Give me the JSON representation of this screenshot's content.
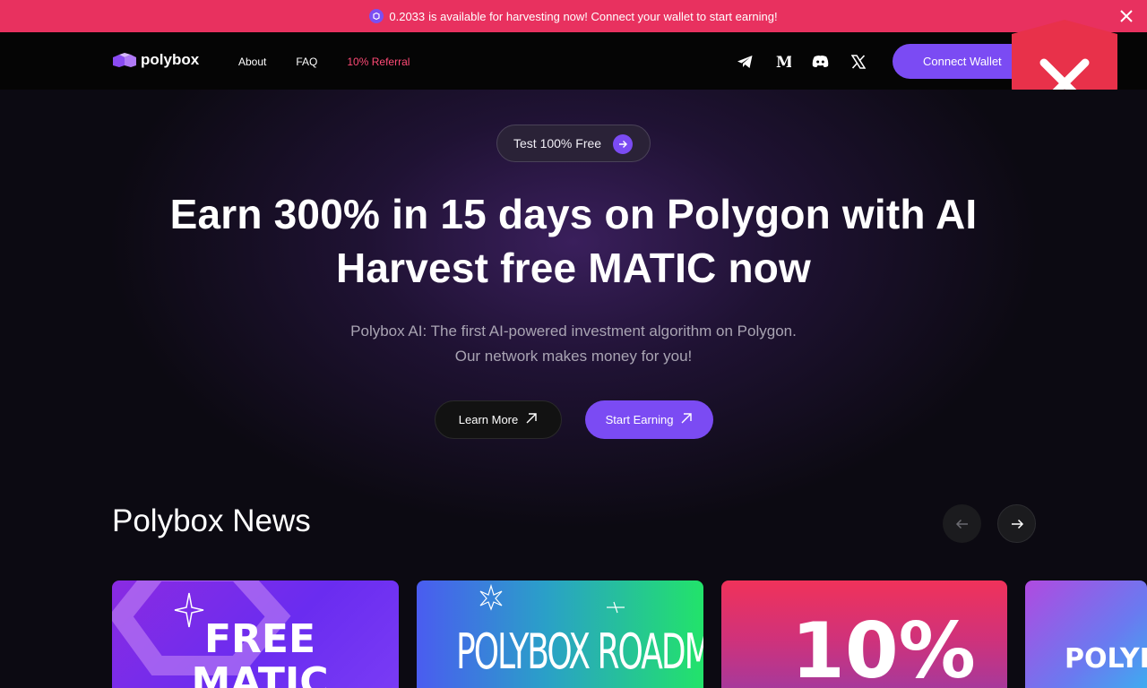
{
  "announcement": {
    "amount": "0.2033",
    "message": "is available for harvesting now! Connect your wallet to start earning!"
  },
  "header": {
    "brand": "polybox",
    "nav": [
      {
        "label": "About"
      },
      {
        "label": "FAQ"
      },
      {
        "label": "10% Referral"
      }
    ],
    "socials": [
      "telegram-icon",
      "medium-icon",
      "discord-icon",
      "x-icon"
    ],
    "connect_label": "Connect Wallet"
  },
  "hero": {
    "pill_label": "Test 100% Free",
    "headline_line1": "Earn 300% in 15 days on Polygon with AI",
    "headline_line2": "Harvest free MATIC now",
    "sub_line1": "Polybox AI: The first AI-powered investment algorithm on Polygon.",
    "sub_line2": "Our network makes money for you!",
    "learn_more": "Learn More",
    "start_earning": "Start Earning"
  },
  "news": {
    "title": "Polybox News",
    "cards": [
      {
        "text": "FREE MATIC"
      },
      {
        "text": "POLYBOX ROADMAP"
      },
      {
        "text": "10%"
      },
      {
        "text": "POLYBO"
      }
    ]
  },
  "colors": {
    "announce_bg": "#e8315f",
    "accent": "#7b4bf3",
    "referral": "#ff4a76",
    "shield": "#e8314a"
  }
}
